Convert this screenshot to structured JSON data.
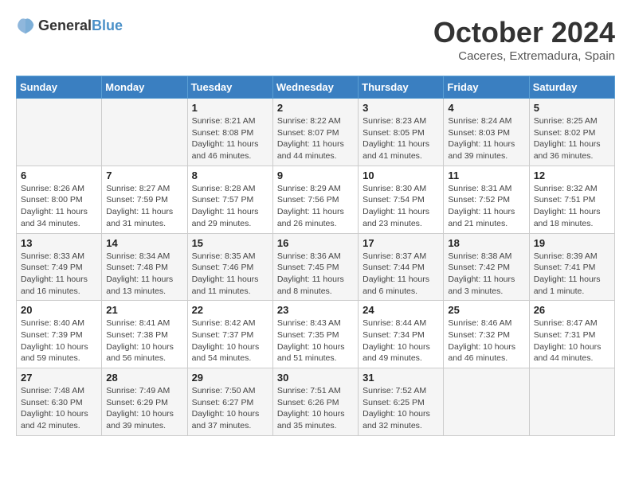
{
  "logo": {
    "general": "General",
    "blue": "Blue"
  },
  "title": "October 2024",
  "location": "Caceres, Extremadura, Spain",
  "days_header": [
    "Sunday",
    "Monday",
    "Tuesday",
    "Wednesday",
    "Thursday",
    "Friday",
    "Saturday"
  ],
  "weeks": [
    [
      {
        "day": "",
        "info": ""
      },
      {
        "day": "",
        "info": ""
      },
      {
        "day": "1",
        "info": "Sunrise: 8:21 AM\nSunset: 8:08 PM\nDaylight: 11 hours and 46 minutes."
      },
      {
        "day": "2",
        "info": "Sunrise: 8:22 AM\nSunset: 8:07 PM\nDaylight: 11 hours and 44 minutes."
      },
      {
        "day": "3",
        "info": "Sunrise: 8:23 AM\nSunset: 8:05 PM\nDaylight: 11 hours and 41 minutes."
      },
      {
        "day": "4",
        "info": "Sunrise: 8:24 AM\nSunset: 8:03 PM\nDaylight: 11 hours and 39 minutes."
      },
      {
        "day": "5",
        "info": "Sunrise: 8:25 AM\nSunset: 8:02 PM\nDaylight: 11 hours and 36 minutes."
      }
    ],
    [
      {
        "day": "6",
        "info": "Sunrise: 8:26 AM\nSunset: 8:00 PM\nDaylight: 11 hours and 34 minutes."
      },
      {
        "day": "7",
        "info": "Sunrise: 8:27 AM\nSunset: 7:59 PM\nDaylight: 11 hours and 31 minutes."
      },
      {
        "day": "8",
        "info": "Sunrise: 8:28 AM\nSunset: 7:57 PM\nDaylight: 11 hours and 29 minutes."
      },
      {
        "day": "9",
        "info": "Sunrise: 8:29 AM\nSunset: 7:56 PM\nDaylight: 11 hours and 26 minutes."
      },
      {
        "day": "10",
        "info": "Sunrise: 8:30 AM\nSunset: 7:54 PM\nDaylight: 11 hours and 23 minutes."
      },
      {
        "day": "11",
        "info": "Sunrise: 8:31 AM\nSunset: 7:52 PM\nDaylight: 11 hours and 21 minutes."
      },
      {
        "day": "12",
        "info": "Sunrise: 8:32 AM\nSunset: 7:51 PM\nDaylight: 11 hours and 18 minutes."
      }
    ],
    [
      {
        "day": "13",
        "info": "Sunrise: 8:33 AM\nSunset: 7:49 PM\nDaylight: 11 hours and 16 minutes."
      },
      {
        "day": "14",
        "info": "Sunrise: 8:34 AM\nSunset: 7:48 PM\nDaylight: 11 hours and 13 minutes."
      },
      {
        "day": "15",
        "info": "Sunrise: 8:35 AM\nSunset: 7:46 PM\nDaylight: 11 hours and 11 minutes."
      },
      {
        "day": "16",
        "info": "Sunrise: 8:36 AM\nSunset: 7:45 PM\nDaylight: 11 hours and 8 minutes."
      },
      {
        "day": "17",
        "info": "Sunrise: 8:37 AM\nSunset: 7:44 PM\nDaylight: 11 hours and 6 minutes."
      },
      {
        "day": "18",
        "info": "Sunrise: 8:38 AM\nSunset: 7:42 PM\nDaylight: 11 hours and 3 minutes."
      },
      {
        "day": "19",
        "info": "Sunrise: 8:39 AM\nSunset: 7:41 PM\nDaylight: 11 hours and 1 minute."
      }
    ],
    [
      {
        "day": "20",
        "info": "Sunrise: 8:40 AM\nSunset: 7:39 PM\nDaylight: 10 hours and 59 minutes."
      },
      {
        "day": "21",
        "info": "Sunrise: 8:41 AM\nSunset: 7:38 PM\nDaylight: 10 hours and 56 minutes."
      },
      {
        "day": "22",
        "info": "Sunrise: 8:42 AM\nSunset: 7:37 PM\nDaylight: 10 hours and 54 minutes."
      },
      {
        "day": "23",
        "info": "Sunrise: 8:43 AM\nSunset: 7:35 PM\nDaylight: 10 hours and 51 minutes."
      },
      {
        "day": "24",
        "info": "Sunrise: 8:44 AM\nSunset: 7:34 PM\nDaylight: 10 hours and 49 minutes."
      },
      {
        "day": "25",
        "info": "Sunrise: 8:46 AM\nSunset: 7:32 PM\nDaylight: 10 hours and 46 minutes."
      },
      {
        "day": "26",
        "info": "Sunrise: 8:47 AM\nSunset: 7:31 PM\nDaylight: 10 hours and 44 minutes."
      }
    ],
    [
      {
        "day": "27",
        "info": "Sunrise: 7:48 AM\nSunset: 6:30 PM\nDaylight: 10 hours and 42 minutes."
      },
      {
        "day": "28",
        "info": "Sunrise: 7:49 AM\nSunset: 6:29 PM\nDaylight: 10 hours and 39 minutes."
      },
      {
        "day": "29",
        "info": "Sunrise: 7:50 AM\nSunset: 6:27 PM\nDaylight: 10 hours and 37 minutes."
      },
      {
        "day": "30",
        "info": "Sunrise: 7:51 AM\nSunset: 6:26 PM\nDaylight: 10 hours and 35 minutes."
      },
      {
        "day": "31",
        "info": "Sunrise: 7:52 AM\nSunset: 6:25 PM\nDaylight: 10 hours and 32 minutes."
      },
      {
        "day": "",
        "info": ""
      },
      {
        "day": "",
        "info": ""
      }
    ]
  ]
}
